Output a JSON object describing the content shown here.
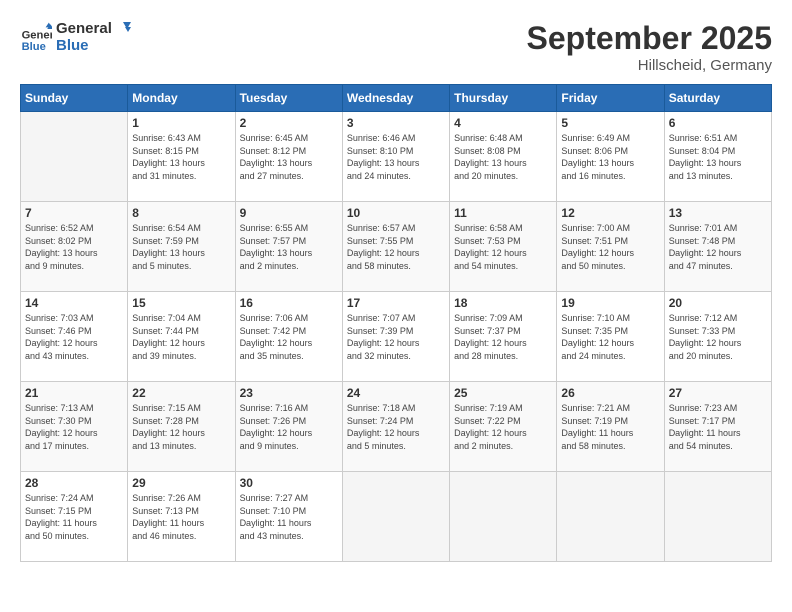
{
  "header": {
    "logo_line1": "General",
    "logo_line2": "Blue",
    "month_title": "September 2025",
    "location": "Hillscheid, Germany"
  },
  "weekdays": [
    "Sunday",
    "Monday",
    "Tuesday",
    "Wednesday",
    "Thursday",
    "Friday",
    "Saturday"
  ],
  "weeks": [
    [
      {
        "day": "",
        "info": ""
      },
      {
        "day": "1",
        "info": "Sunrise: 6:43 AM\nSunset: 8:15 PM\nDaylight: 13 hours\nand 31 minutes."
      },
      {
        "day": "2",
        "info": "Sunrise: 6:45 AM\nSunset: 8:12 PM\nDaylight: 13 hours\nand 27 minutes."
      },
      {
        "day": "3",
        "info": "Sunrise: 6:46 AM\nSunset: 8:10 PM\nDaylight: 13 hours\nand 24 minutes."
      },
      {
        "day": "4",
        "info": "Sunrise: 6:48 AM\nSunset: 8:08 PM\nDaylight: 13 hours\nand 20 minutes."
      },
      {
        "day": "5",
        "info": "Sunrise: 6:49 AM\nSunset: 8:06 PM\nDaylight: 13 hours\nand 16 minutes."
      },
      {
        "day": "6",
        "info": "Sunrise: 6:51 AM\nSunset: 8:04 PM\nDaylight: 13 hours\nand 13 minutes."
      }
    ],
    [
      {
        "day": "7",
        "info": "Sunrise: 6:52 AM\nSunset: 8:02 PM\nDaylight: 13 hours\nand 9 minutes."
      },
      {
        "day": "8",
        "info": "Sunrise: 6:54 AM\nSunset: 7:59 PM\nDaylight: 13 hours\nand 5 minutes."
      },
      {
        "day": "9",
        "info": "Sunrise: 6:55 AM\nSunset: 7:57 PM\nDaylight: 13 hours\nand 2 minutes."
      },
      {
        "day": "10",
        "info": "Sunrise: 6:57 AM\nSunset: 7:55 PM\nDaylight: 12 hours\nand 58 minutes."
      },
      {
        "day": "11",
        "info": "Sunrise: 6:58 AM\nSunset: 7:53 PM\nDaylight: 12 hours\nand 54 minutes."
      },
      {
        "day": "12",
        "info": "Sunrise: 7:00 AM\nSunset: 7:51 PM\nDaylight: 12 hours\nand 50 minutes."
      },
      {
        "day": "13",
        "info": "Sunrise: 7:01 AM\nSunset: 7:48 PM\nDaylight: 12 hours\nand 47 minutes."
      }
    ],
    [
      {
        "day": "14",
        "info": "Sunrise: 7:03 AM\nSunset: 7:46 PM\nDaylight: 12 hours\nand 43 minutes."
      },
      {
        "day": "15",
        "info": "Sunrise: 7:04 AM\nSunset: 7:44 PM\nDaylight: 12 hours\nand 39 minutes."
      },
      {
        "day": "16",
        "info": "Sunrise: 7:06 AM\nSunset: 7:42 PM\nDaylight: 12 hours\nand 35 minutes."
      },
      {
        "day": "17",
        "info": "Sunrise: 7:07 AM\nSunset: 7:39 PM\nDaylight: 12 hours\nand 32 minutes."
      },
      {
        "day": "18",
        "info": "Sunrise: 7:09 AM\nSunset: 7:37 PM\nDaylight: 12 hours\nand 28 minutes."
      },
      {
        "day": "19",
        "info": "Sunrise: 7:10 AM\nSunset: 7:35 PM\nDaylight: 12 hours\nand 24 minutes."
      },
      {
        "day": "20",
        "info": "Sunrise: 7:12 AM\nSunset: 7:33 PM\nDaylight: 12 hours\nand 20 minutes."
      }
    ],
    [
      {
        "day": "21",
        "info": "Sunrise: 7:13 AM\nSunset: 7:30 PM\nDaylight: 12 hours\nand 17 minutes."
      },
      {
        "day": "22",
        "info": "Sunrise: 7:15 AM\nSunset: 7:28 PM\nDaylight: 12 hours\nand 13 minutes."
      },
      {
        "day": "23",
        "info": "Sunrise: 7:16 AM\nSunset: 7:26 PM\nDaylight: 12 hours\nand 9 minutes."
      },
      {
        "day": "24",
        "info": "Sunrise: 7:18 AM\nSunset: 7:24 PM\nDaylight: 12 hours\nand 5 minutes."
      },
      {
        "day": "25",
        "info": "Sunrise: 7:19 AM\nSunset: 7:22 PM\nDaylight: 12 hours\nand 2 minutes."
      },
      {
        "day": "26",
        "info": "Sunrise: 7:21 AM\nSunset: 7:19 PM\nDaylight: 11 hours\nand 58 minutes."
      },
      {
        "day": "27",
        "info": "Sunrise: 7:23 AM\nSunset: 7:17 PM\nDaylight: 11 hours\nand 54 minutes."
      }
    ],
    [
      {
        "day": "28",
        "info": "Sunrise: 7:24 AM\nSunset: 7:15 PM\nDaylight: 11 hours\nand 50 minutes."
      },
      {
        "day": "29",
        "info": "Sunrise: 7:26 AM\nSunset: 7:13 PM\nDaylight: 11 hours\nand 46 minutes."
      },
      {
        "day": "30",
        "info": "Sunrise: 7:27 AM\nSunset: 7:10 PM\nDaylight: 11 hours\nand 43 minutes."
      },
      {
        "day": "",
        "info": ""
      },
      {
        "day": "",
        "info": ""
      },
      {
        "day": "",
        "info": ""
      },
      {
        "day": "",
        "info": ""
      }
    ]
  ]
}
